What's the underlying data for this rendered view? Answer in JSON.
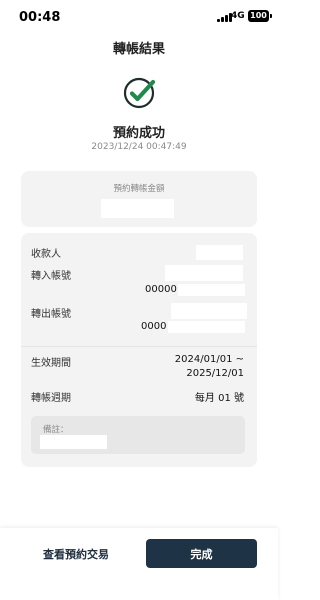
{
  "status_bar": {
    "time": "00:48",
    "network": "4G",
    "battery": "100"
  },
  "header": {
    "title": "轉帳結果"
  },
  "result": {
    "title": "預約成功",
    "timestamp": "2023/12/24 00:47:49",
    "icon": "check-icon",
    "accent": "#1f8a4c"
  },
  "amount": {
    "label": "預約轉帳金額"
  },
  "details": {
    "payee_label": "收款人",
    "to_account_label": "轉入帳號",
    "to_account_suffix": "00000",
    "from_account_label": "轉出帳號",
    "from_account_suffix": "0000",
    "period_label": "生效期間",
    "period_start": "2024/01/01 ~",
    "period_end": "2025/12/01",
    "cycle_label": "轉帳週期",
    "cycle_value": "每月 01 號",
    "note_label": "備註："
  },
  "actions": {
    "view_label": "查看預約交易",
    "done_label": "完成",
    "done_color": "#1f3347"
  }
}
